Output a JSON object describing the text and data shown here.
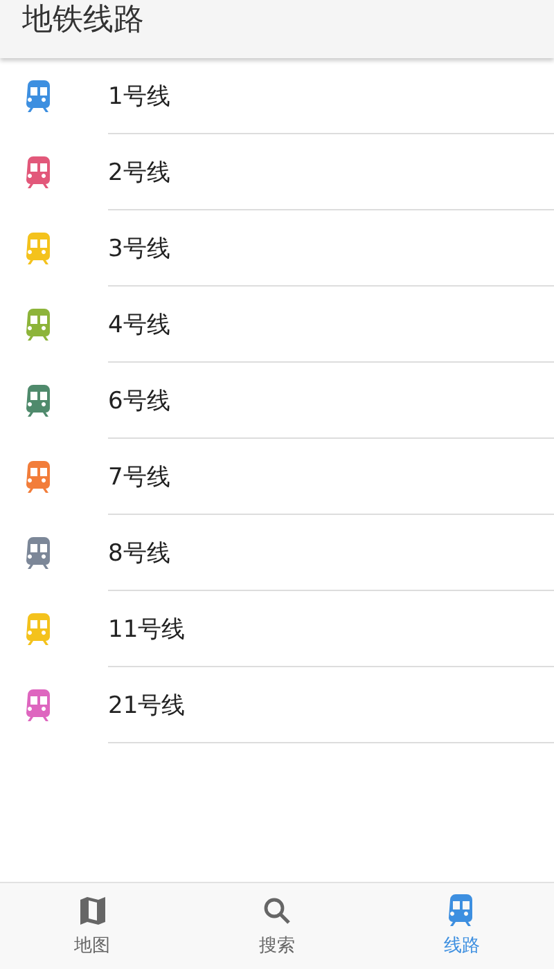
{
  "header": {
    "title": "地铁线路"
  },
  "lines": [
    {
      "name": "1号线",
      "color": "#3d8fe0"
    },
    {
      "name": "2号线",
      "color": "#e2587a"
    },
    {
      "name": "3号线",
      "color": "#f4c21c"
    },
    {
      "name": "4号线",
      "color": "#8db43a"
    },
    {
      "name": "6号线",
      "color": "#4f8a6c"
    },
    {
      "name": "7号线",
      "color": "#f27d3a"
    },
    {
      "name": "8号线",
      "color": "#7c8798"
    },
    {
      "name": "11号线",
      "color": "#f4c21c"
    },
    {
      "name": "21号线",
      "color": "#de66bf"
    }
  ],
  "nav": [
    {
      "kind": "map",
      "label": "地图",
      "selected": false
    },
    {
      "kind": "search",
      "label": "搜索",
      "selected": false
    },
    {
      "kind": "train",
      "label": "线路",
      "selected": true
    }
  ]
}
